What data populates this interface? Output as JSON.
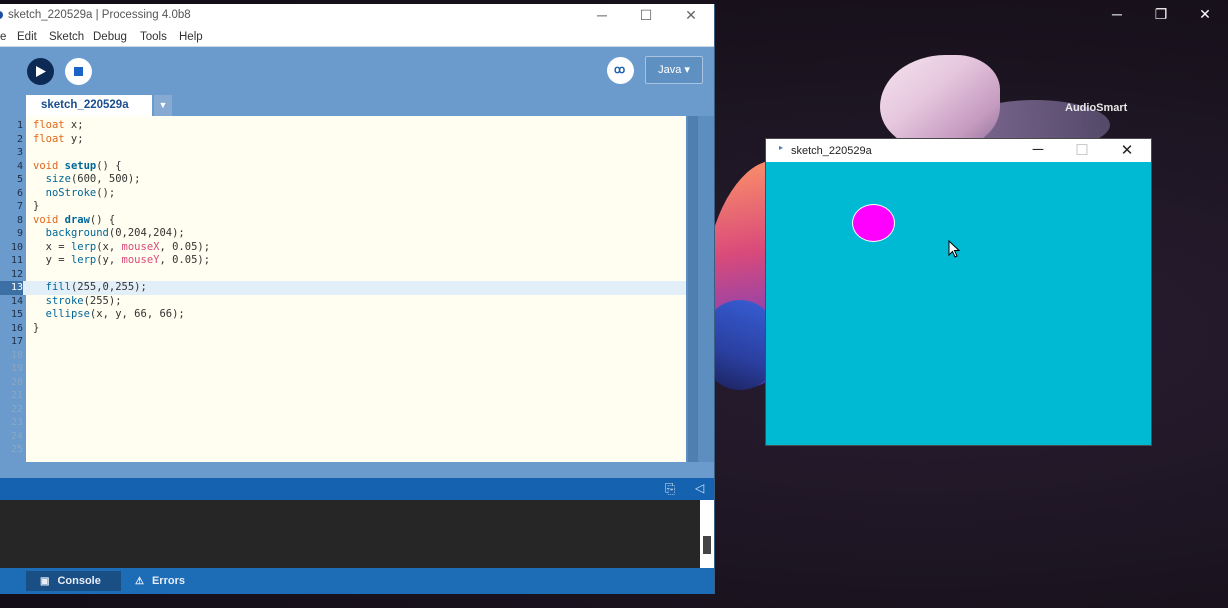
{
  "desktop": {
    "watermark": "AudioSmart",
    "controls": [
      "─",
      "❐",
      "✕"
    ]
  },
  "ide": {
    "title": "sketch_220529a | Processing 4.0b8",
    "window_controls": [
      "─",
      "☐",
      "✕"
    ],
    "menu": [
      "e",
      "Edit",
      "Sketch",
      "Debug",
      "Tools",
      "Help"
    ],
    "mode": "Java ▾",
    "tab_label": "sketch_220529a",
    "tab_arrow": "▼",
    "debug_icon": "butterfly-icon",
    "code_lines": [
      {
        "num": "1",
        "code": "float x;"
      },
      {
        "num": "2",
        "code": "float y;"
      },
      {
        "num": "3",
        "code": ""
      },
      {
        "num": "4",
        "code": "void setup() {"
      },
      {
        "num": "5",
        "code": "  size(600, 500);"
      },
      {
        "num": "6",
        "code": "  noStroke();"
      },
      {
        "num": "7",
        "code": "}"
      },
      {
        "num": "8",
        "code": "void draw() {"
      },
      {
        "num": "9",
        "code": "  background(0,204,204);"
      },
      {
        "num": "10",
        "code": "  x = lerp(x, mouseX, 0.05);"
      },
      {
        "num": "11",
        "code": "  y = lerp(y, mouseY, 0.05);"
      },
      {
        "num": "12",
        "code": ""
      },
      {
        "num": "13",
        "code": "  fill(255,0,255);"
      },
      {
        "num": "14",
        "code": "  stroke(255);"
      },
      {
        "num": "15",
        "code": "  ellipse(x, y, 66, 66);"
      },
      {
        "num": "16",
        "code": "}"
      },
      {
        "num": "17",
        "code": ""
      },
      {
        "num": "18",
        "code": ""
      },
      {
        "num": "19",
        "code": ""
      },
      {
        "num": "20",
        "code": ""
      },
      {
        "num": "21",
        "code": ""
      },
      {
        "num": "22",
        "code": ""
      },
      {
        "num": "23",
        "code": ""
      },
      {
        "num": "24",
        "code": ""
      },
      {
        "num": "25",
        "code": ""
      }
    ],
    "highlight_line": 13,
    "bottom_tabs": {
      "console": "Console",
      "errors": "Errors"
    },
    "colors": {
      "accent": "#1462b0",
      "editor_bg": "#fffef0"
    }
  },
  "sketch": {
    "title": "sketch_220529a",
    "controls": [
      "─",
      "☐",
      "✕"
    ],
    "background": "#00b9d3",
    "ellipse_color": "#ff00ff"
  }
}
